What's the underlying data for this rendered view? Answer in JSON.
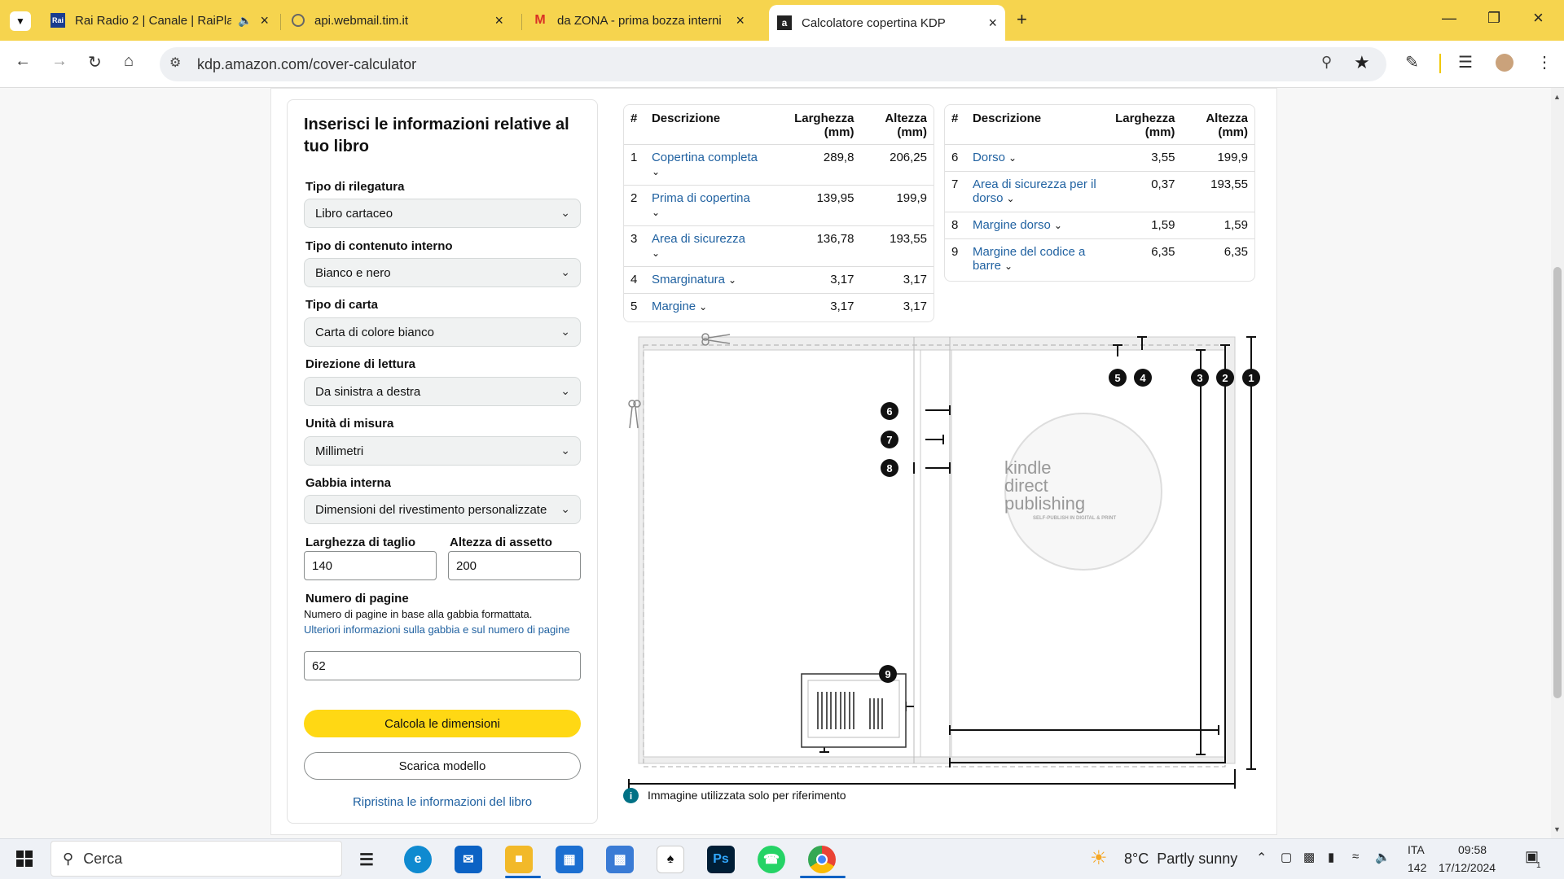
{
  "browser": {
    "tabs": [
      {
        "title": "Rai Radio 2 | Canale | RaiPlay",
        "favicon": "rai-icon",
        "audio": true
      },
      {
        "title": "api.webmail.tim.it",
        "favicon": "globe-icon"
      },
      {
        "title": "da ZONA - prima bozza interni",
        "favicon": "gmail-icon"
      },
      {
        "title": "Calcolatore copertina KDP",
        "favicon": "amazon-icon",
        "active": true
      }
    ],
    "url": "kdp.amazon.com/cover-calculator"
  },
  "form": {
    "heading": "Inserisci le informazioni relative al tuo libro",
    "fields": [
      {
        "label": "Tipo di rilegatura",
        "value": "Libro cartaceo"
      },
      {
        "label": "Tipo di contenuto interno",
        "value": "Bianco e nero"
      },
      {
        "label": "Tipo di carta",
        "value": "Carta di colore bianco"
      },
      {
        "label": "Direzione di lettura",
        "value": "Da sinistra a destra"
      },
      {
        "label": "Unità di misura",
        "value": "Millimetri"
      },
      {
        "label": "Gabbia interna",
        "value": "Dimensioni del rivestimento personalizzate"
      }
    ],
    "trim_width_label": "Larghezza di taglio",
    "trim_width_value": "140",
    "trim_height_label": "Altezza di assetto",
    "trim_height_value": "200",
    "pages_label": "Numero di pagine",
    "pages_help": "Numero di pagine in base alla gabbia formattata.",
    "pages_link": "Ulteriori informazioni sulla gabbia e sul numero di pagine",
    "pages_value": "62",
    "calc_button": "Calcola le dimensioni",
    "download_button": "Scarica modello",
    "reset_link": "Ripristina le informazioni del libro"
  },
  "table_left": {
    "headers": [
      "#",
      "Descrizione",
      "Larghezza (mm)",
      "Altezza (mm)"
    ],
    "rows": [
      {
        "n": "1",
        "desc": "Copertina completa",
        "w": "289,8",
        "h": "206,25"
      },
      {
        "n": "2",
        "desc": "Prima di copertina",
        "w": "139,95",
        "h": "199,9"
      },
      {
        "n": "3",
        "desc": "Area di sicurezza",
        "w": "136,78",
        "h": "193,55"
      },
      {
        "n": "4",
        "desc": "Smarginatura",
        "w": "3,17",
        "h": "3,17"
      },
      {
        "n": "5",
        "desc": "Margine",
        "w": "3,17",
        "h": "3,17"
      }
    ]
  },
  "table_right": {
    "headers": [
      "#",
      "Descrizione",
      "Larghezza (mm)",
      "Altezza (mm)"
    ],
    "rows": [
      {
        "n": "6",
        "desc": "Dorso",
        "w": "3,55",
        "h": "199,9"
      },
      {
        "n": "7",
        "desc": "Area di sicurezza per il dorso",
        "w": "0,37",
        "h": "193,55"
      },
      {
        "n": "8",
        "desc": "Margine dorso",
        "w": "1,59",
        "h": "1,59"
      },
      {
        "n": "9",
        "desc": "Margine del codice a barre",
        "w": "6,35",
        "h": "6,35"
      }
    ]
  },
  "diagram": {
    "markers": [
      "1",
      "2",
      "3",
      "4",
      "5",
      "6",
      "7",
      "8",
      "9"
    ],
    "logo_line1": "kindle",
    "logo_line2": "direct",
    "logo_line3": "publishing",
    "logo_tag": "SELF-PUBLISH IN DIGITAL & PRINT",
    "note": "Immagine utilizzata solo per riferimento"
  },
  "taskbar": {
    "search": "Cerca",
    "weather": "8°C  Partly sunny",
    "lang": "ITA",
    "lang_sub": "142",
    "time": "09:58",
    "date": "17/12/2024",
    "notif": "1"
  }
}
